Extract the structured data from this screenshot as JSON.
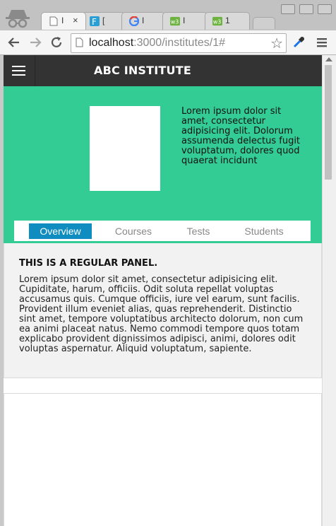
{
  "browser": {
    "tabs": [
      {
        "title": "I",
        "favicon": "page-icon",
        "active": true
      },
      {
        "title": "[",
        "favicon": "f-icon",
        "active": false
      },
      {
        "title": "I",
        "favicon": "google-icon",
        "active": false
      },
      {
        "title": "I",
        "favicon": "w3-icon",
        "active": false
      },
      {
        "title": "1",
        "favicon": "w3-icon",
        "active": false
      }
    ],
    "close_glyph": "×",
    "address": {
      "host": "localhost",
      "path": ":3000/institutes/1#"
    }
  },
  "app": {
    "brand": "ABC INSTITUTE",
    "hero_text": "Lorem ipsum dolor sit amet, consectetur adipisicing elit. Dolorum assumenda delectus fugit voluptatum, dolores quod quaerat incidunt",
    "tabs": [
      {
        "label": "Overview",
        "active": true
      },
      {
        "label": "Courses",
        "active": false
      },
      {
        "label": "Tests",
        "active": false
      },
      {
        "label": "Students",
        "active": false
      }
    ],
    "panel": {
      "heading": "THIS IS A REGULAR PANEL.",
      "body": "Lorem ipsum dolor sit amet, consectetur adipisicing elit. Cupiditate, harum, officiis. Odit soluta repellat voluptas accusamus quis. Cumque officiis, iure vel earum, sunt facilis. Provident illum eveniet alias, quas reprehenderit. Distinctio sint amet, tempore voluptatibus architecto dolorum, non cum ea animi placeat natus. Nemo commodi tempore quos totam explicabo provident dignissimos adipisci, animi, dolores odit voluptas aspernatur. Aliquid voluptatum, sapiente."
    }
  },
  "colors": {
    "hero": "#33cc95",
    "appbar": "#333333",
    "active_tab": "#0f8dc0"
  }
}
